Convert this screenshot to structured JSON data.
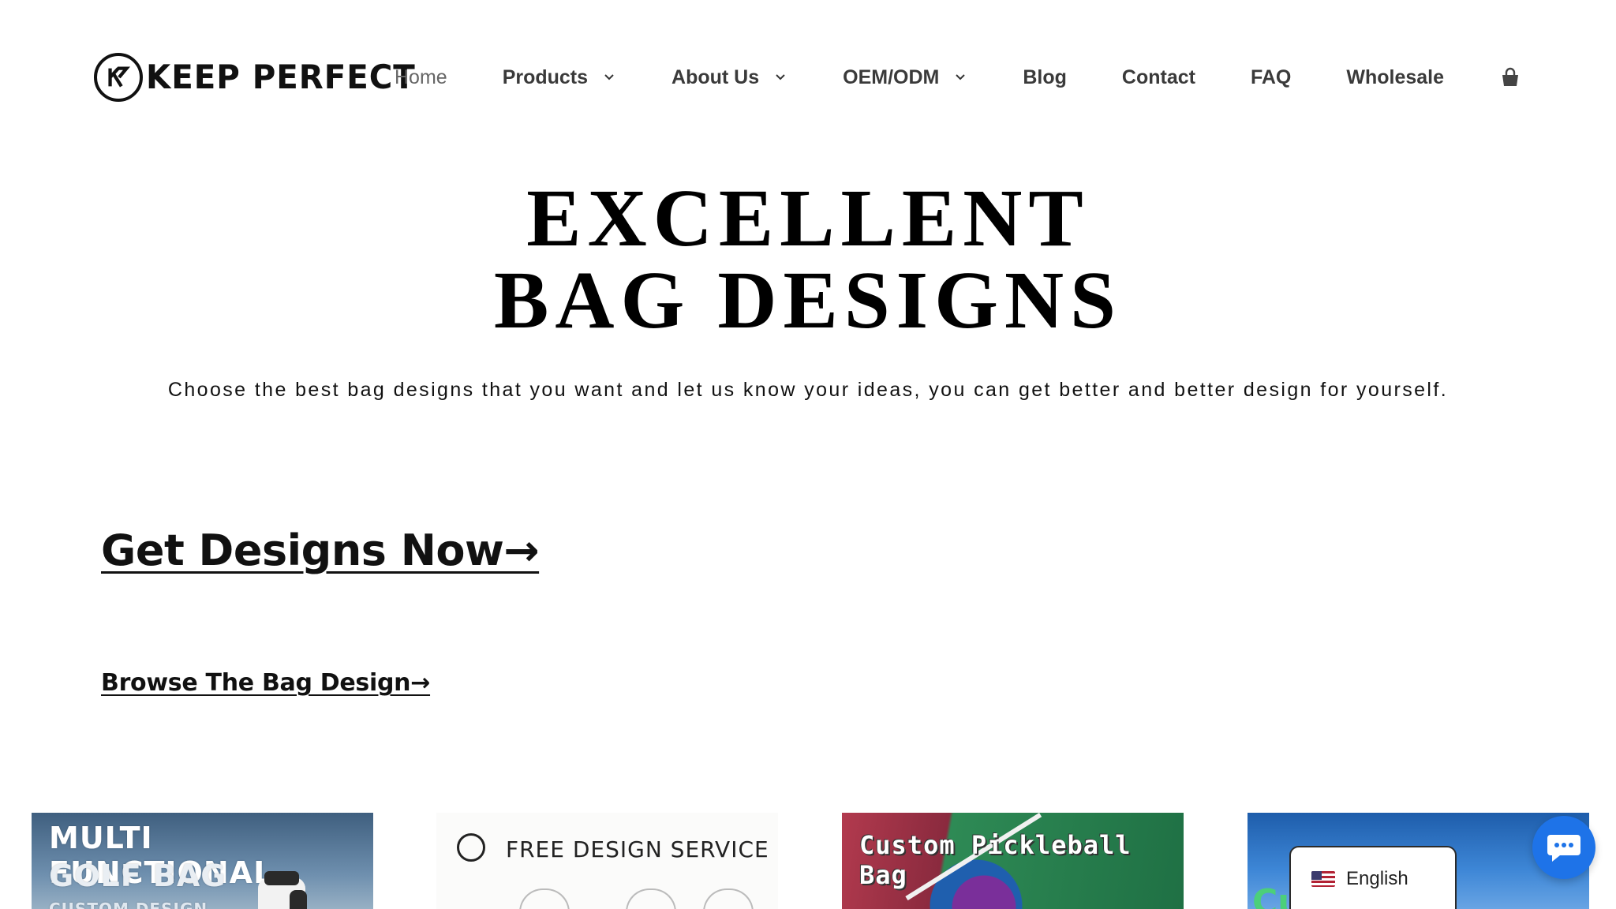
{
  "brand": {
    "name": "KEEP PERFECT",
    "logo_icon": "kp-monogram-icon"
  },
  "nav": {
    "items": [
      {
        "label": "Home",
        "has_dropdown": false
      },
      {
        "label": "Products",
        "has_dropdown": true
      },
      {
        "label": "About Us",
        "has_dropdown": true
      },
      {
        "label": "OEM/ODM",
        "has_dropdown": true
      },
      {
        "label": "Blog",
        "has_dropdown": false
      },
      {
        "label": "Contact",
        "has_dropdown": false
      },
      {
        "label": "FAQ",
        "has_dropdown": false
      },
      {
        "label": "Wholesale",
        "has_dropdown": false
      }
    ],
    "cart_icon": "shopping-bag-icon"
  },
  "hero": {
    "title_line1": "EXCELLENT",
    "title_line2": "BAG DESIGNS",
    "subtitle": "Choose the best bag designs that you want and let us know your ideas, you can get better and better design for yourself."
  },
  "cta": {
    "primary": "Get Designs Now→",
    "secondary": "Browse The Bag Design→"
  },
  "cards": [
    {
      "line1": "MULTI FUNCTIONAL",
      "line2": "GOLF BAG",
      "line3": "CUSTOM DESIGN"
    },
    {
      "title": "FREE DESIGN SERVICE"
    },
    {
      "title": "Custom Pickleball Bag"
    },
    {
      "title": "Cu"
    }
  ],
  "language": {
    "label": "English",
    "flag": "us-flag-icon"
  },
  "chat": {
    "icon": "chat-bubble-icon",
    "color": "#1e73e8"
  }
}
